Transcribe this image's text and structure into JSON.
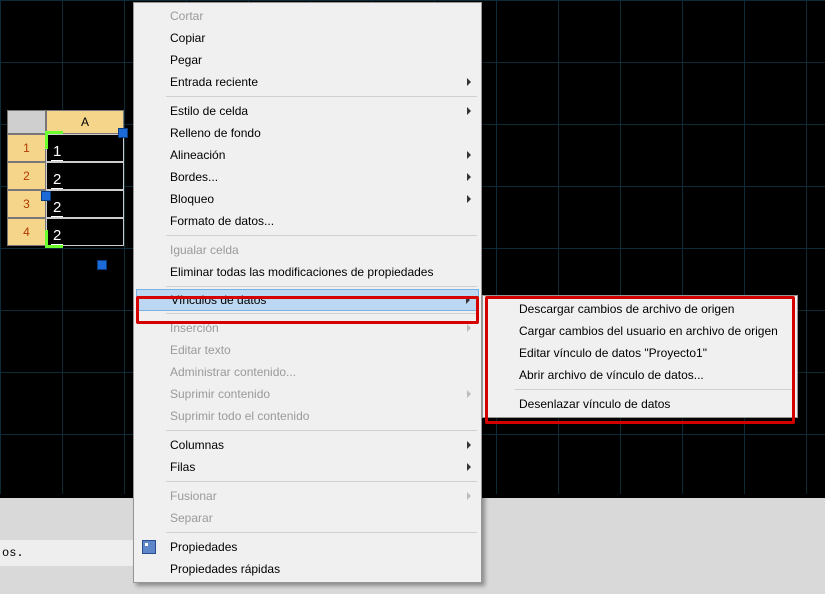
{
  "table": {
    "col_header": "A",
    "row_headers": [
      "1",
      "2",
      "3",
      "4"
    ],
    "cells": [
      "1",
      "2",
      "2",
      "2"
    ]
  },
  "cmd_suffix": "os.",
  "menu1": {
    "items": [
      {
        "label": "Cortar",
        "disabled": true
      },
      {
        "label": "Copiar"
      },
      {
        "label": "Pegar"
      },
      {
        "label": "Entrada reciente",
        "arrow": true
      },
      {
        "sep": true
      },
      {
        "label": "Estilo de celda",
        "arrow": true
      },
      {
        "label": "Relleno de fondo"
      },
      {
        "label": "Alineación",
        "arrow": true
      },
      {
        "label": "Bordes...",
        "arrow": true
      },
      {
        "label": "Bloqueo",
        "arrow": true
      },
      {
        "label": "Formato de datos..."
      },
      {
        "sep": true
      },
      {
        "label": "Igualar celda",
        "disabled": true
      },
      {
        "label": "Eliminar todas las modificaciones de propiedades"
      },
      {
        "sep": true
      },
      {
        "label": "Vínculos de datos",
        "arrow": true,
        "highlight": true
      },
      {
        "sep": true
      },
      {
        "label": "Inserción",
        "arrow": true,
        "disabled": true
      },
      {
        "label": "Editar texto",
        "disabled": true
      },
      {
        "label": "Administrar contenido...",
        "disabled": true
      },
      {
        "label": "Suprimir contenido",
        "arrow": true,
        "disabled": true
      },
      {
        "label": "Suprimir todo el contenido",
        "disabled": true
      },
      {
        "sep": true
      },
      {
        "label": "Columnas",
        "arrow": true
      },
      {
        "label": "Filas",
        "arrow": true
      },
      {
        "sep": true
      },
      {
        "label": "Fusionar",
        "arrow": true,
        "disabled": true
      },
      {
        "label": "Separar",
        "disabled": true
      },
      {
        "sep": true
      },
      {
        "label": "Propiedades",
        "icon": "props"
      },
      {
        "label": "Propiedades rápidas"
      }
    ]
  },
  "menu2": {
    "items": [
      {
        "label": "Descargar cambios de archivo de origen"
      },
      {
        "label": "Cargar cambios del usuario en archivo de origen"
      },
      {
        "label": "Editar vínculo de datos \"Proyecto1\""
      },
      {
        "label": "Abrir archivo de vínculo de datos..."
      },
      {
        "sep": true
      },
      {
        "label": "Desenlazar vínculo de datos"
      }
    ]
  }
}
